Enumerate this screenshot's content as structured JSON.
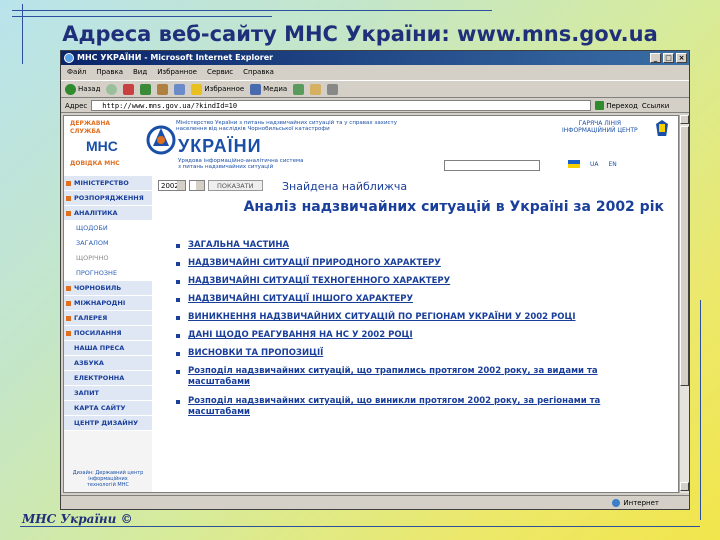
{
  "slide": {
    "title": "Адреса веб-сайту МНС України: www.mns.gov.ua",
    "footer": "МНС України ©"
  },
  "browser": {
    "window_title": "МНС УКРАЇНИ - Microsoft Internet Explorer",
    "menu": [
      "Файл",
      "Правка",
      "Вид",
      "Избранное",
      "Сервис",
      "Справка"
    ],
    "toolbar": {
      "back": "Назад",
      "favorites": "Избранное",
      "media": "Медиа"
    },
    "address_label": "Адрес",
    "address_value": "http://www.mns.gov.ua/?kindId=10",
    "go_label": "Переход",
    "links_label": "Ссылки",
    "status_text": "",
    "zone_label": "Интернет"
  },
  "site": {
    "logo_left": "ДЕРЖАВНА\nСЛУЖБА",
    "logo_mns": "МНС",
    "logo_ukraine": "УКРАЇНИ",
    "logo_ministry": "Міністерство України з питань надзвичайних ситуацій та у справах захисту населення від наслідків Чорнобильської катастрофи",
    "logo_sub": "Урядова інформаційно-аналітична система\nз питань надзвичайних ситуацій",
    "logo_spec": "ДОВІДКА МНС",
    "hotline": "ГАРЯЧА ЛІНІЯ\nІНФОРМАЦІЙНИЙ ЦЕНТР",
    "lang_ua": "UA",
    "lang_en": "EN",
    "nav": [
      {
        "label": "МІНІСТЕРСТВО",
        "type": "main"
      },
      {
        "label": "РОЗПОРЯДЖЕННЯ",
        "type": "main"
      },
      {
        "label": "АНАЛІТИКА",
        "type": "main"
      },
      {
        "label": "ЩОДОБИ",
        "type": "sub"
      },
      {
        "label": "ЗАГАЛОМ",
        "type": "sub"
      },
      {
        "label": "ЩОРІЧНО",
        "type": "muted"
      },
      {
        "label": "ПРОГНОЗНЕ",
        "type": "sub"
      },
      {
        "label": "ЧОРНОБИЛЬ",
        "type": "main"
      },
      {
        "label": "МІЖНАРОДНІ ЗВ'ЯЗКИ",
        "type": "main"
      },
      {
        "label": "ГАЛЕРЕЯ",
        "type": "main"
      },
      {
        "label": "ПОСИЛАННЯ",
        "type": "main"
      },
      {
        "label": "НАША ПРЕСА",
        "type": "main"
      },
      {
        "label": "АЗБУКА ВИЖИВАННЯ",
        "type": "main"
      },
      {
        "label": "ЕЛЕКТРОННА КНИЖКА",
        "type": "main"
      },
      {
        "label": "ЗАПИТ ВІДВІДУВАЧА",
        "type": "main"
      },
      {
        "label": "КАРТА САЙТУ",
        "type": "main"
      },
      {
        "label": "ЦЕНТР ДИЗАЙНУ",
        "type": "main"
      }
    ],
    "bottom_box": "Дизайн: Державний центр\nінформаційних\nтехнологій МНС",
    "year_value": "2002",
    "show_button": "ПОКАЗАТИ",
    "found_text": "Знайдена найближча",
    "report_title": "Аналіз надзвичайних ситуацій в Україні за 2002 рік",
    "links": [
      "ЗАГАЛЬНА ЧАСТИНА",
      "НАДЗВИЧАЙНІ СИТУАЦІЇ ПРИРОДНОГО ХАРАКТЕРУ",
      "НАДЗВИЧАЙНІ СИТУАЦІЇ ТЕХНОГЕННОГО ХАРАКТЕРУ",
      "НАДЗВИЧАЙНІ СИТУАЦІЇ ІНШОГО ХАРАКТЕРУ",
      "ВИНИКНЕННЯ НАДЗВИЧАЙНИХ СИТУАЦІЙ ПО РЕГІОНАМ УКРАЇНИ У 2002 РОЦІ",
      "ДАНІ ЩОДО РЕАГУВАННЯ НА НС У 2002 РОЦІ",
      "ВИСНОВКИ ТА ПРОПОЗИЦІЇ",
      "Розподіл надзвичайних ситуацій, що трапились протягом 2002 року, за видами та масштабами",
      "Розподіл надзвичайних ситуацій, що виникли протягом 2002 року, за регіонами та масштабами"
    ]
  }
}
